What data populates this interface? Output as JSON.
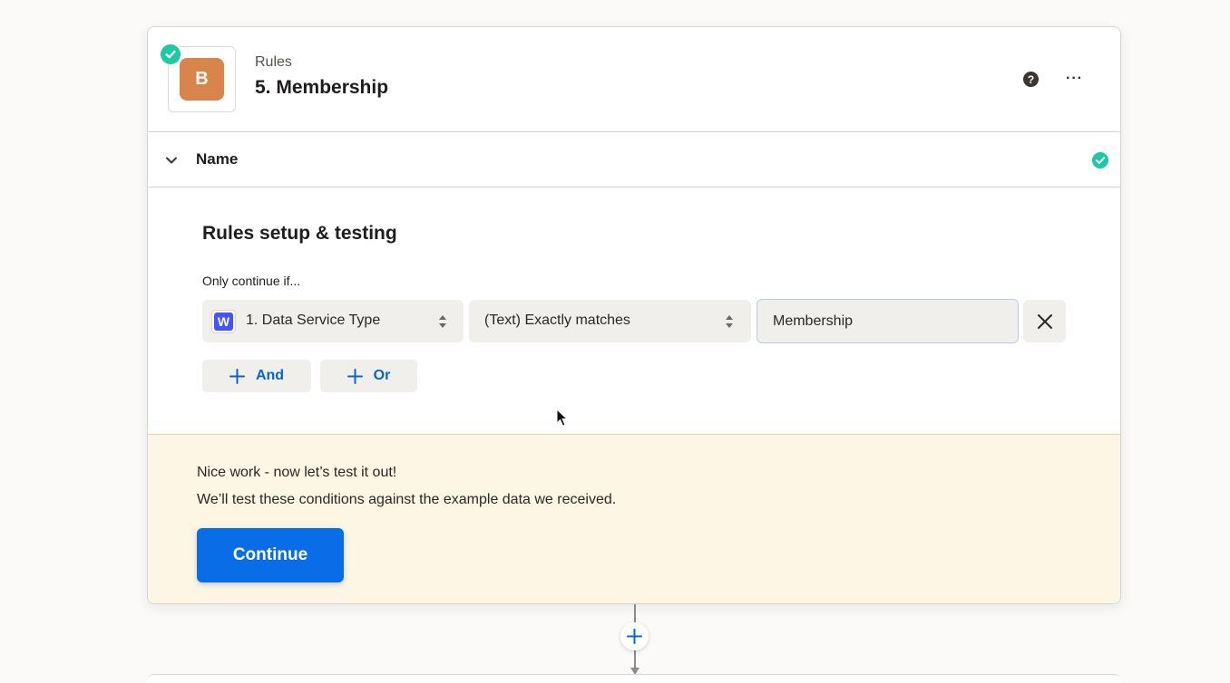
{
  "step": {
    "app_badge_letter": "B",
    "app_badge_color": "#d9844a",
    "app_name": "Rules",
    "title": "5. Membership",
    "status_icon": "check-circle-icon",
    "help_icon": "question-icon",
    "more_icon": "more-icon",
    "more_glyph": "···"
  },
  "name_section": {
    "label": "Name",
    "expand_icon": "chevron-down-icon",
    "status_icon": "check-circle-icon"
  },
  "rules": {
    "title": "Rules setup & testing",
    "condition_intro": "Only continue if...",
    "conditions": [
      {
        "field_icon_letter": "W",
        "field": "1. Data Service Type",
        "operator": "(Text) Exactly matches",
        "value": "Membership"
      }
    ],
    "and_label": "And",
    "or_label": "Or"
  },
  "notice": {
    "line1": "Nice work - now let’s test it out!",
    "line2": "We’ll test these conditions against the example data we received.",
    "continue_label": "Continue"
  },
  "colors": {
    "accent": "#0a6de8",
    "success": "#1fc8a4",
    "notice_bg": "#fdf6e4",
    "link": "#0a63c9"
  }
}
